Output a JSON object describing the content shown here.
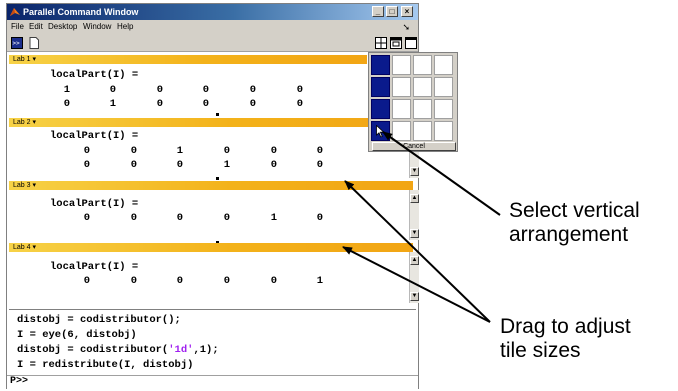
{
  "window": {
    "title": "Parallel Command Window",
    "controls": [
      "_",
      "□",
      "×"
    ]
  },
  "menu": {
    "items": [
      "File",
      "Edit",
      "Desktop",
      "Window",
      "Help"
    ],
    "undock_arrow": "➘"
  },
  "toolbar": {
    "left_icons": [
      "command-window-icon",
      "new-document-icon"
    ],
    "right_icons": [
      "tile-grid-icon",
      "tile-single-icon",
      "maximize-icon"
    ]
  },
  "labs": [
    {
      "header": "Lab 1 ▾",
      "expr": "localPart(I) =",
      "rows": [
        [
          "1",
          "0",
          "0",
          "0",
          "0",
          "0"
        ],
        [
          "0",
          "1",
          "0",
          "0",
          "0",
          "0"
        ]
      ]
    },
    {
      "header": "Lab 2 ▾",
      "expr": "localPart(I) =",
      "rows": [
        [
          "0",
          "0",
          "1",
          "0",
          "0",
          "0"
        ],
        [
          "0",
          "0",
          "0",
          "1",
          "0",
          "0"
        ]
      ]
    },
    {
      "header": "Lab 3 ▾",
      "expr": "localPart(I) =",
      "rows": [
        [
          "0",
          "0",
          "0",
          "0",
          "1",
          "0"
        ]
      ]
    },
    {
      "header": "Lab 4 ▾",
      "expr": "localPart(I) =",
      "rows": [
        [
          "0",
          "0",
          "0",
          "0",
          "0",
          "1"
        ]
      ]
    }
  ],
  "commands": {
    "line1": "distobj = codistributor();",
    "line2": "I = eye(6, distobj)",
    "line3_a": "distobj = codistributor(",
    "line3_str": "'1d'",
    "line3_b": ",1);",
    "line4": "I = redistribute(I, distobj)",
    "prompt": "P>>"
  },
  "popup": {
    "grid_cols": 4,
    "grid_rows": 4,
    "selected_column": 1,
    "selected_rows": 4,
    "cancel_label": "Cancel"
  },
  "annotations": {
    "select_line1": "Select vertical",
    "select_line2": "arrangement",
    "drag_line1": "Drag to adjust",
    "drag_line2": "tile sizes"
  },
  "colors": {
    "lab_header": "#f3b21a",
    "title_bar": "#0a246a",
    "grid_selected": "#0a1a8c",
    "string_literal": "#a020f0"
  }
}
